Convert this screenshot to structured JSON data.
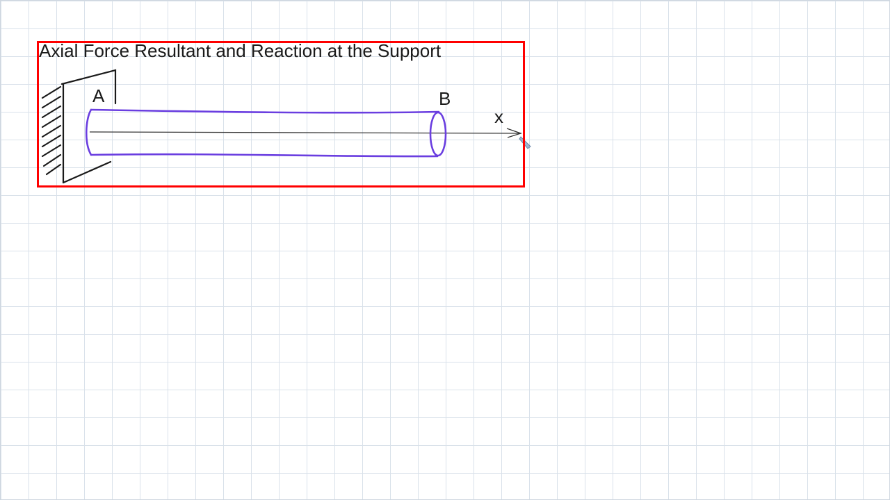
{
  "title": "Axial Force Resultant and Reaction at the Support",
  "labels": {
    "a": "A",
    "b": "B",
    "x": "x"
  },
  "colors": {
    "frame": "#ff0000",
    "bar": "#6a3ee0",
    "ink": "#1a1a1a",
    "grid": "#d9e1ea"
  }
}
